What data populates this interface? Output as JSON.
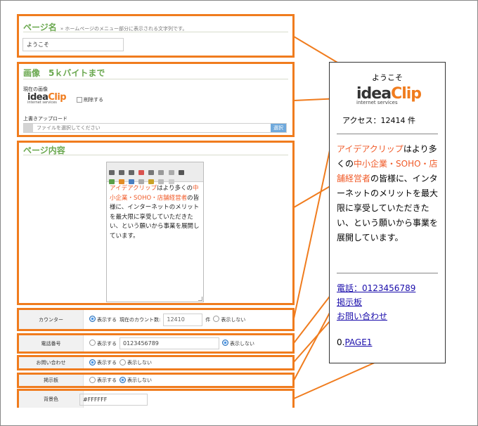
{
  "page_name": {
    "title": "ページ名",
    "hint": "» ホームページのメニュー部分に表示される文字列です。",
    "value": "ようこそ"
  },
  "image": {
    "title": "画像　5ｋバイトまで",
    "current_label": "現在の画像",
    "logo_main": "idea",
    "logo_accent": "Clip",
    "logo_sub": "internet services",
    "delete_label": "削除する",
    "upload_label": "上書きアップロード",
    "file_placeholder": "ファイルを選択してください",
    "select_button": "選択"
  },
  "content": {
    "title": "ページ内容",
    "seg1": "アイデアクリップ",
    "seg2": "はより多くの",
    "seg3": "中小企業・SOHO・店舗経営者",
    "seg4": "の皆様に、インターネットのメリットを最大限に享受していただきたい、という願いから事業を展開しています。"
  },
  "rows": {
    "counter": {
      "label": "カウンター",
      "show": "表示する",
      "current_count_label": "現在のカウント数:",
      "count_value": "12410",
      "unit": "件",
      "hide": "表示しない"
    },
    "phone": {
      "label": "電話番号",
      "show": "表示する",
      "value": "0123456789",
      "hide": "表示しない"
    },
    "inquiry": {
      "label": "お問い合わせ",
      "show": "表示する",
      "hide": "表示しない"
    },
    "bbs": {
      "label": "掲示板",
      "show": "表示する",
      "hide": "表示しない"
    },
    "bgcolor": {
      "label": "背景色",
      "value": "#FFFFFF"
    }
  },
  "preview": {
    "title": "ようこそ",
    "logo_main": "idea",
    "logo_accent": "Clip",
    "logo_sub": "internet services",
    "access": "アクセス：12414 件",
    "seg1": "アイデアクリップ",
    "seg2": "はより多くの",
    "seg3": "中小企業・SOHO・店舗経営者",
    "seg4": "の皆様に、インターネットのメリットを最大限に享受していただきたい、という願いから事業を展開しています。",
    "phone_link": "電話：0123456789",
    "bbs_link": "掲示板",
    "inquiry_link": "お問い合わせ",
    "page_prefix": "0.",
    "page_link": "PAGE1"
  },
  "colors": {
    "accent_orange": "#f07c1e",
    "title_green": "#6aa84f",
    "highlight_red": "#f05a28",
    "link_blue": "#1a0dab"
  }
}
